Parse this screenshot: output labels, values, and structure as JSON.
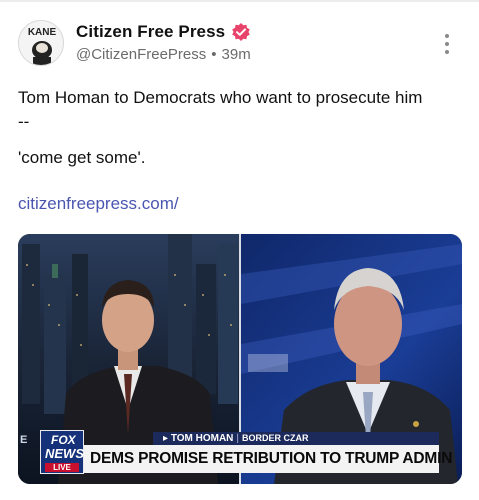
{
  "account": {
    "display_name": "Citizen Free Press",
    "handle": "@CitizenFreePress",
    "separator": "•",
    "time_ago": "39m",
    "avatar_text": "KANE",
    "verified_color": "#e8436b"
  },
  "post": {
    "text_line1": "Tom Homan to Democrats who want to prosecute him",
    "text_line2": "--",
    "quote": "'come get some'.",
    "link": "citizenfreepress.com/"
  },
  "media": {
    "chyron_name": "TOM HOMAN",
    "chyron_separator": "|",
    "chyron_role": "BORDER CZAR",
    "chyron_headline": "DEMS PROMISE RETRIBUTION TO TRUMP ADMIN",
    "logo_fox": "FOX",
    "logo_news": "NEWS",
    "logo_live": "LIVE",
    "corner_mark": "E"
  },
  "icons": {
    "verified": "verified-badge-icon",
    "more": "more-vertical-icon",
    "play": "play-triangle-icon"
  }
}
